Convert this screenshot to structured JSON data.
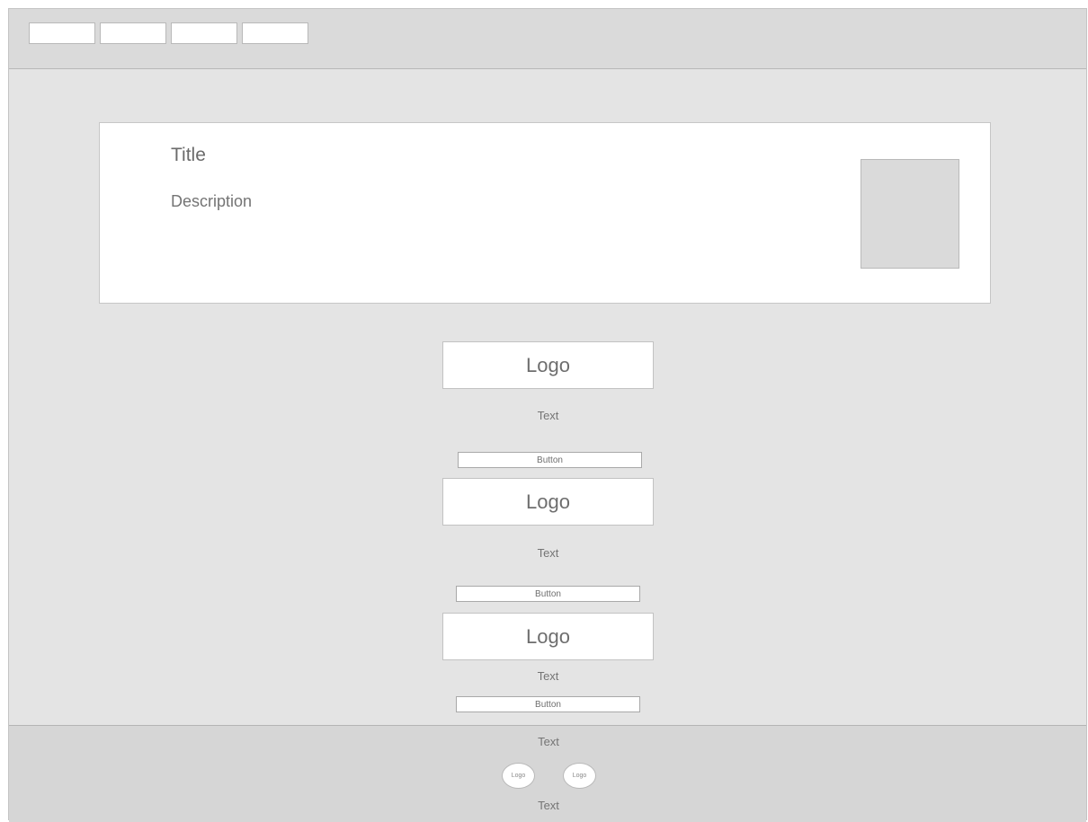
{
  "header": {
    "tabs": [
      {
        "label": ""
      },
      {
        "label": ""
      },
      {
        "label": ""
      },
      {
        "label": ""
      }
    ]
  },
  "hero": {
    "title": "Title",
    "description": "Description"
  },
  "items": [
    {
      "logo": "Logo",
      "text": "Text",
      "button": "Button"
    },
    {
      "logo": "Logo",
      "text": "Text",
      "button": "Button"
    },
    {
      "logo": "Logo",
      "text": "Text",
      "button": "Button"
    }
  ],
  "footer": {
    "text_top": "Text",
    "logos": [
      {
        "label": "Logo"
      },
      {
        "label": "Logo"
      }
    ],
    "text_bottom": "Text"
  }
}
